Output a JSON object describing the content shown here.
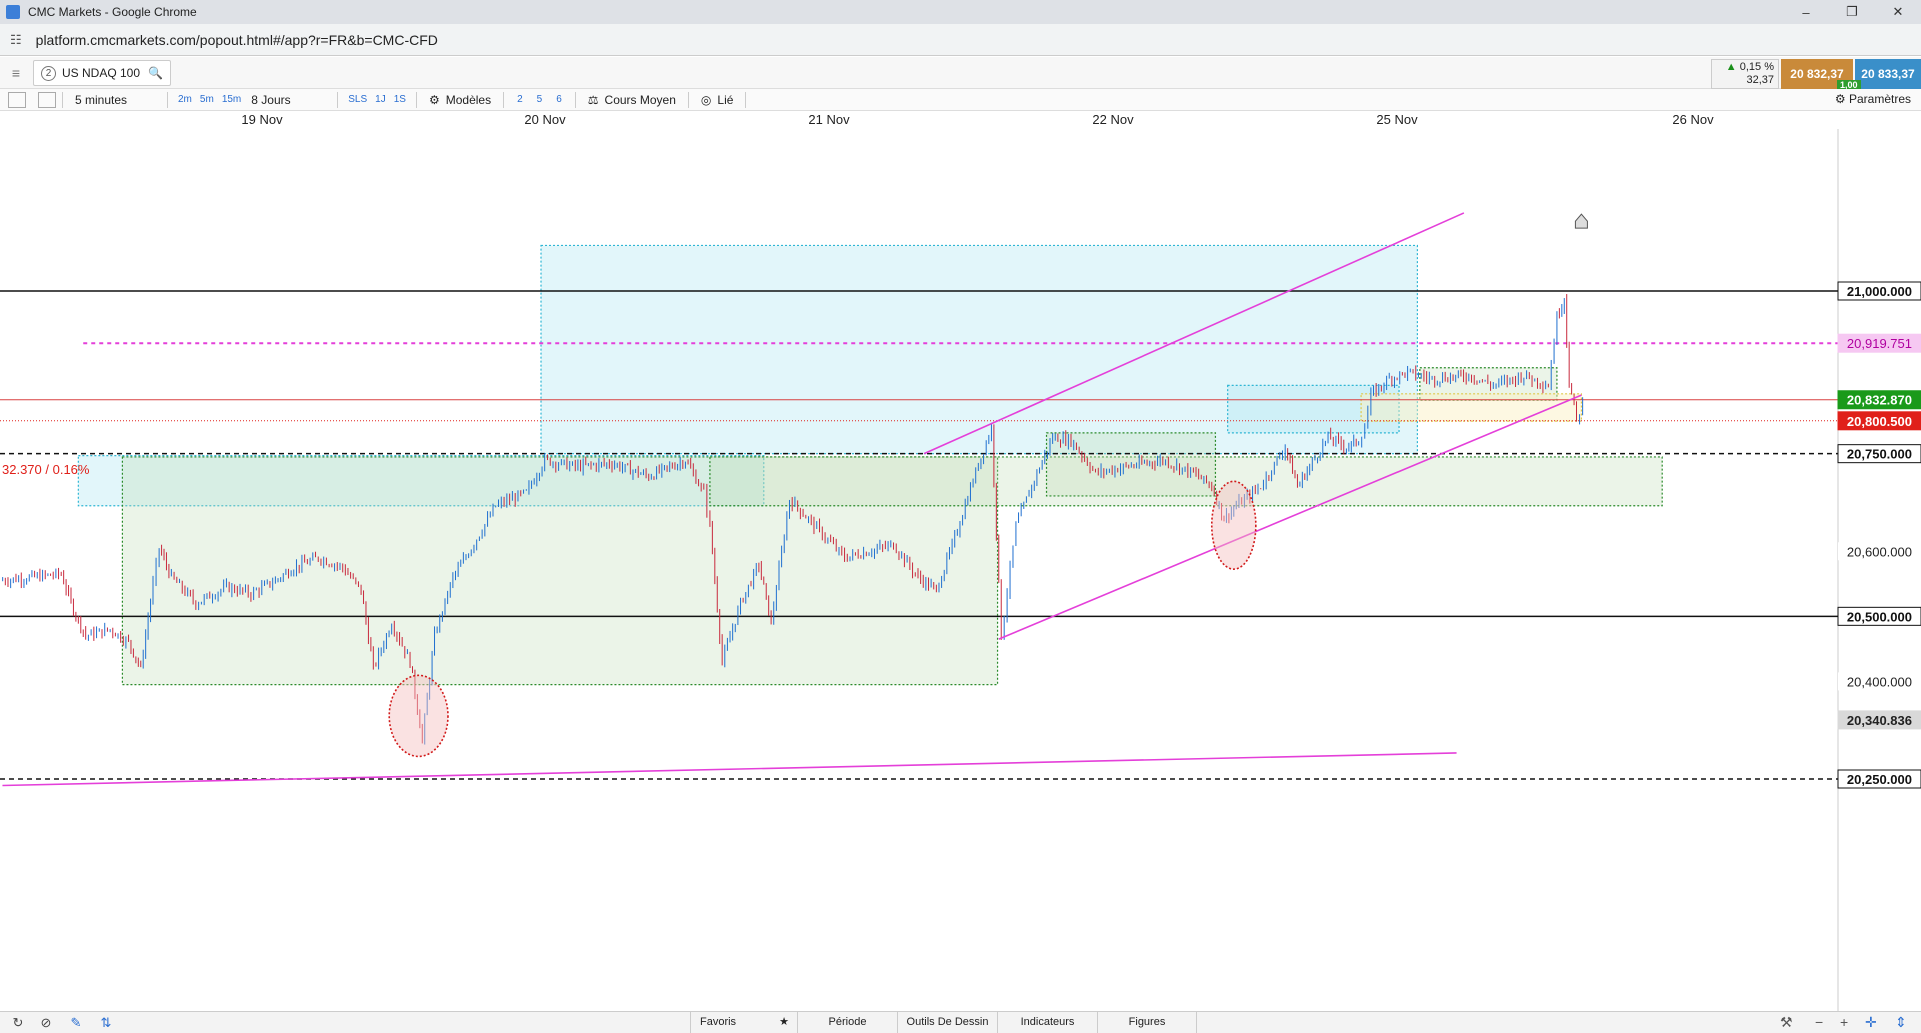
{
  "window": {
    "title": "CMC Markets - Google Chrome",
    "url": "platform.cmcmarkets.com/popout.html#/app?r=FR&b=CMC-CFD"
  },
  "instrument": {
    "tab_number": "2",
    "name": "US NDAQ 100"
  },
  "quote": {
    "change_pct": "0,15 %",
    "change_abs": "32,37",
    "sell": "20 832,37",
    "buy": "20 833,37",
    "spread": "1,00"
  },
  "toolbar": {
    "interval": "5 minutes",
    "quick_intervals": [
      "2m",
      "5m",
      "15m"
    ],
    "range": "8 Jours",
    "range_buttons": [
      "SLS",
      "1J",
      "1S"
    ],
    "templates": "Modèles",
    "template_slots": [
      "2",
      "5",
      "6"
    ],
    "price_type": "Cours Moyen",
    "linked": "Lié",
    "settings": "Paramètres"
  },
  "dates": [
    "19 Nov",
    "20 Nov",
    "21 Nov",
    "22 Nov",
    "25 Nov",
    "26 Nov"
  ],
  "chart_data": {
    "type": "candlestick",
    "y_axis_labels": [
      "21,000.000",
      "20,600.000",
      "20,500.000",
      "20,400.000",
      "20,250.000"
    ],
    "price_levels": [
      {
        "value": "21,000.000",
        "style": "solid-black"
      },
      {
        "value": "20,919.751",
        "style": "dashed-magenta",
        "color": "#e43fd9"
      },
      {
        "value": "20,832.870",
        "style": "current-price",
        "color": "#1a9a1a"
      },
      {
        "value": "20,800.500",
        "style": "dotted-red",
        "color": "#e0201a"
      },
      {
        "value": "20,750.000",
        "style": "dashed-black"
      },
      {
        "value": "20,500.000",
        "style": "solid-black"
      },
      {
        "value": "20,340.836",
        "style": "label",
        "color": "#d9d9d9"
      },
      {
        "value": "20,250.000",
        "style": "dashed-black"
      }
    ],
    "change_annotation": "32.370 / 0.16%",
    "ylim": [
      20230,
      21150
    ],
    "price_path": [
      [
        0,
        20555
      ],
      [
        50,
        20565
      ],
      [
        60,
        20510
      ],
      [
        70,
        20470
      ],
      [
        90,
        20480
      ],
      [
        105,
        20460
      ],
      [
        115,
        20420
      ],
      [
        125,
        20550
      ],
      [
        130,
        20605
      ],
      [
        140,
        20560
      ],
      [
        160,
        20520
      ],
      [
        185,
        20545
      ],
      [
        205,
        20535
      ],
      [
        225,
        20555
      ],
      [
        240,
        20575
      ],
      [
        260,
        20590
      ],
      [
        280,
        20575
      ],
      [
        295,
        20540
      ],
      [
        305,
        20420
      ],
      [
        320,
        20490
      ],
      [
        335,
        20430
      ],
      [
        345,
        20310
      ],
      [
        355,
        20470
      ],
      [
        370,
        20560
      ],
      [
        385,
        20605
      ],
      [
        405,
        20670
      ],
      [
        430,
        20690
      ],
      [
        445,
        20740
      ],
      [
        470,
        20730
      ],
      [
        500,
        20735
      ],
      [
        530,
        20715
      ],
      [
        560,
        20740
      ],
      [
        575,
        20690
      ],
      [
        580,
        20640
      ],
      [
        590,
        20430
      ],
      [
        605,
        20520
      ],
      [
        620,
        20580
      ],
      [
        630,
        20490
      ],
      [
        645,
        20680
      ],
      [
        665,
        20640
      ],
      [
        690,
        20590
      ],
      [
        710,
        20600
      ],
      [
        730,
        20610
      ],
      [
        750,
        20560
      ],
      [
        765,
        20540
      ],
      [
        780,
        20620
      ],
      [
        795,
        20710
      ],
      [
        810,
        20790
      ],
      [
        818,
        20470
      ],
      [
        830,
        20640
      ],
      [
        845,
        20710
      ],
      [
        860,
        20775
      ],
      [
        875,
        20770
      ],
      [
        895,
        20720
      ],
      [
        920,
        20730
      ],
      [
        950,
        20740
      ],
      [
        975,
        20720
      ],
      [
        990,
        20700
      ],
      [
        1000,
        20650
      ],
      [
        1010,
        20670
      ],
      [
        1030,
        20700
      ],
      [
        1050,
        20760
      ],
      [
        1060,
        20700
      ],
      [
        1070,
        20730
      ],
      [
        1085,
        20775
      ],
      [
        1100,
        20760
      ],
      [
        1110,
        20770
      ],
      [
        1115,
        20790
      ],
      [
        1120,
        20840
      ],
      [
        1135,
        20865
      ],
      [
        1150,
        20875
      ],
      [
        1170,
        20865
      ],
      [
        1200,
        20870
      ],
      [
        1220,
        20855
      ],
      [
        1245,
        20870
      ],
      [
        1265,
        20855
      ],
      [
        1272,
        20960
      ],
      [
        1278,
        20990
      ],
      [
        1282,
        20860
      ],
      [
        1288,
        20800
      ],
      [
        1293,
        20830
      ]
    ],
    "zones": [
      {
        "x0": 442,
        "x1": 1158,
        "y0": 21070,
        "y1": 20750,
        "type": "blue"
      },
      {
        "x0": 64,
        "x1": 624,
        "y0": 20747,
        "y1": 20670,
        "type": "blue"
      },
      {
        "x0": 100,
        "x1": 815,
        "y0": 20745,
        "y1": 20395,
        "type": "green"
      },
      {
        "x0": 580,
        "x1": 1358,
        "y0": 20745,
        "y1": 20670,
        "type": "green"
      },
      {
        "x0": 855,
        "x1": 993,
        "y0": 20782,
        "y1": 20685,
        "type": "green"
      },
      {
        "x0": 1003,
        "x1": 1143,
        "y0": 20855,
        "y1": 20782,
        "type": "blue"
      },
      {
        "x0": 1160,
        "x1": 1272,
        "y0": 20882,
        "y1": 20832,
        "type": "green"
      },
      {
        "x0": 1112,
        "x1": 1292,
        "y0": 20842,
        "y1": 20800,
        "type": "yellow"
      }
    ],
    "trendlines": [
      {
        "x0": 755,
        "y0": 20750,
        "x1": 1196,
        "y1": 21120
      },
      {
        "x0": 816,
        "y0": 20465,
        "x1": 1292,
        "y1": 20840
      },
      {
        "x0": 2,
        "y0": 20240,
        "x1": 1190,
        "y1": 20290
      }
    ],
    "ellipses": [
      {
        "cx": 342,
        "cy": 20347,
        "rx": 24,
        "ry": 36
      },
      {
        "cx": 1008,
        "cy": 20640,
        "rx": 18,
        "ry": 39
      }
    ],
    "marker": {
      "x": 1292,
      "y": 21115
    }
  },
  "bottom": {
    "tabs": [
      "Favoris",
      "Période",
      "Outils De Dessin",
      "Indicateurs",
      "Figures"
    ]
  }
}
